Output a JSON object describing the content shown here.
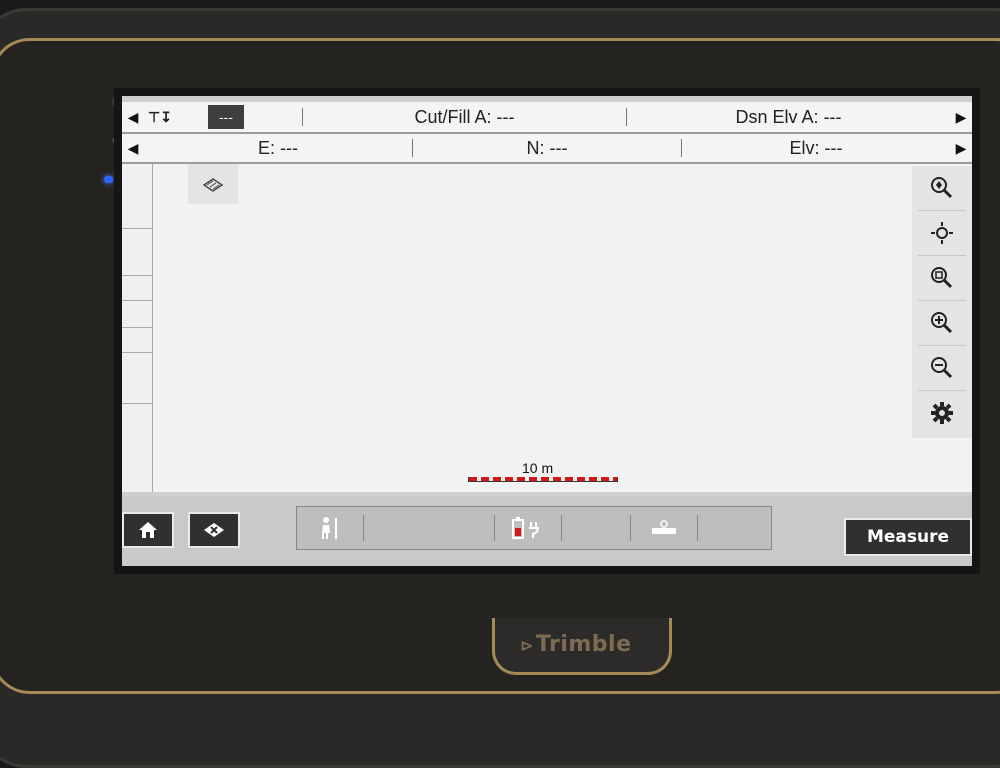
{
  "status_row1": {
    "icon_text": "⊤↧",
    "pill_value": "---",
    "cut_fill": "Cut/Fill A: ---",
    "dsn_elv": "Dsn Elv A: ---"
  },
  "status_row2": {
    "easting": "E: ---",
    "northing": "N: ---",
    "elevation": "Elv: ---"
  },
  "map": {
    "scale_label": "10 m",
    "tools": [
      "zoom-to-extents-icon",
      "pan-to-position-icon",
      "zoom-window-icon",
      "zoom-in-icon",
      "zoom-out-icon",
      "settings-icon"
    ]
  },
  "bottom_bar": {
    "measure_label": "Measure"
  },
  "device": {
    "brand": "Trimble"
  }
}
